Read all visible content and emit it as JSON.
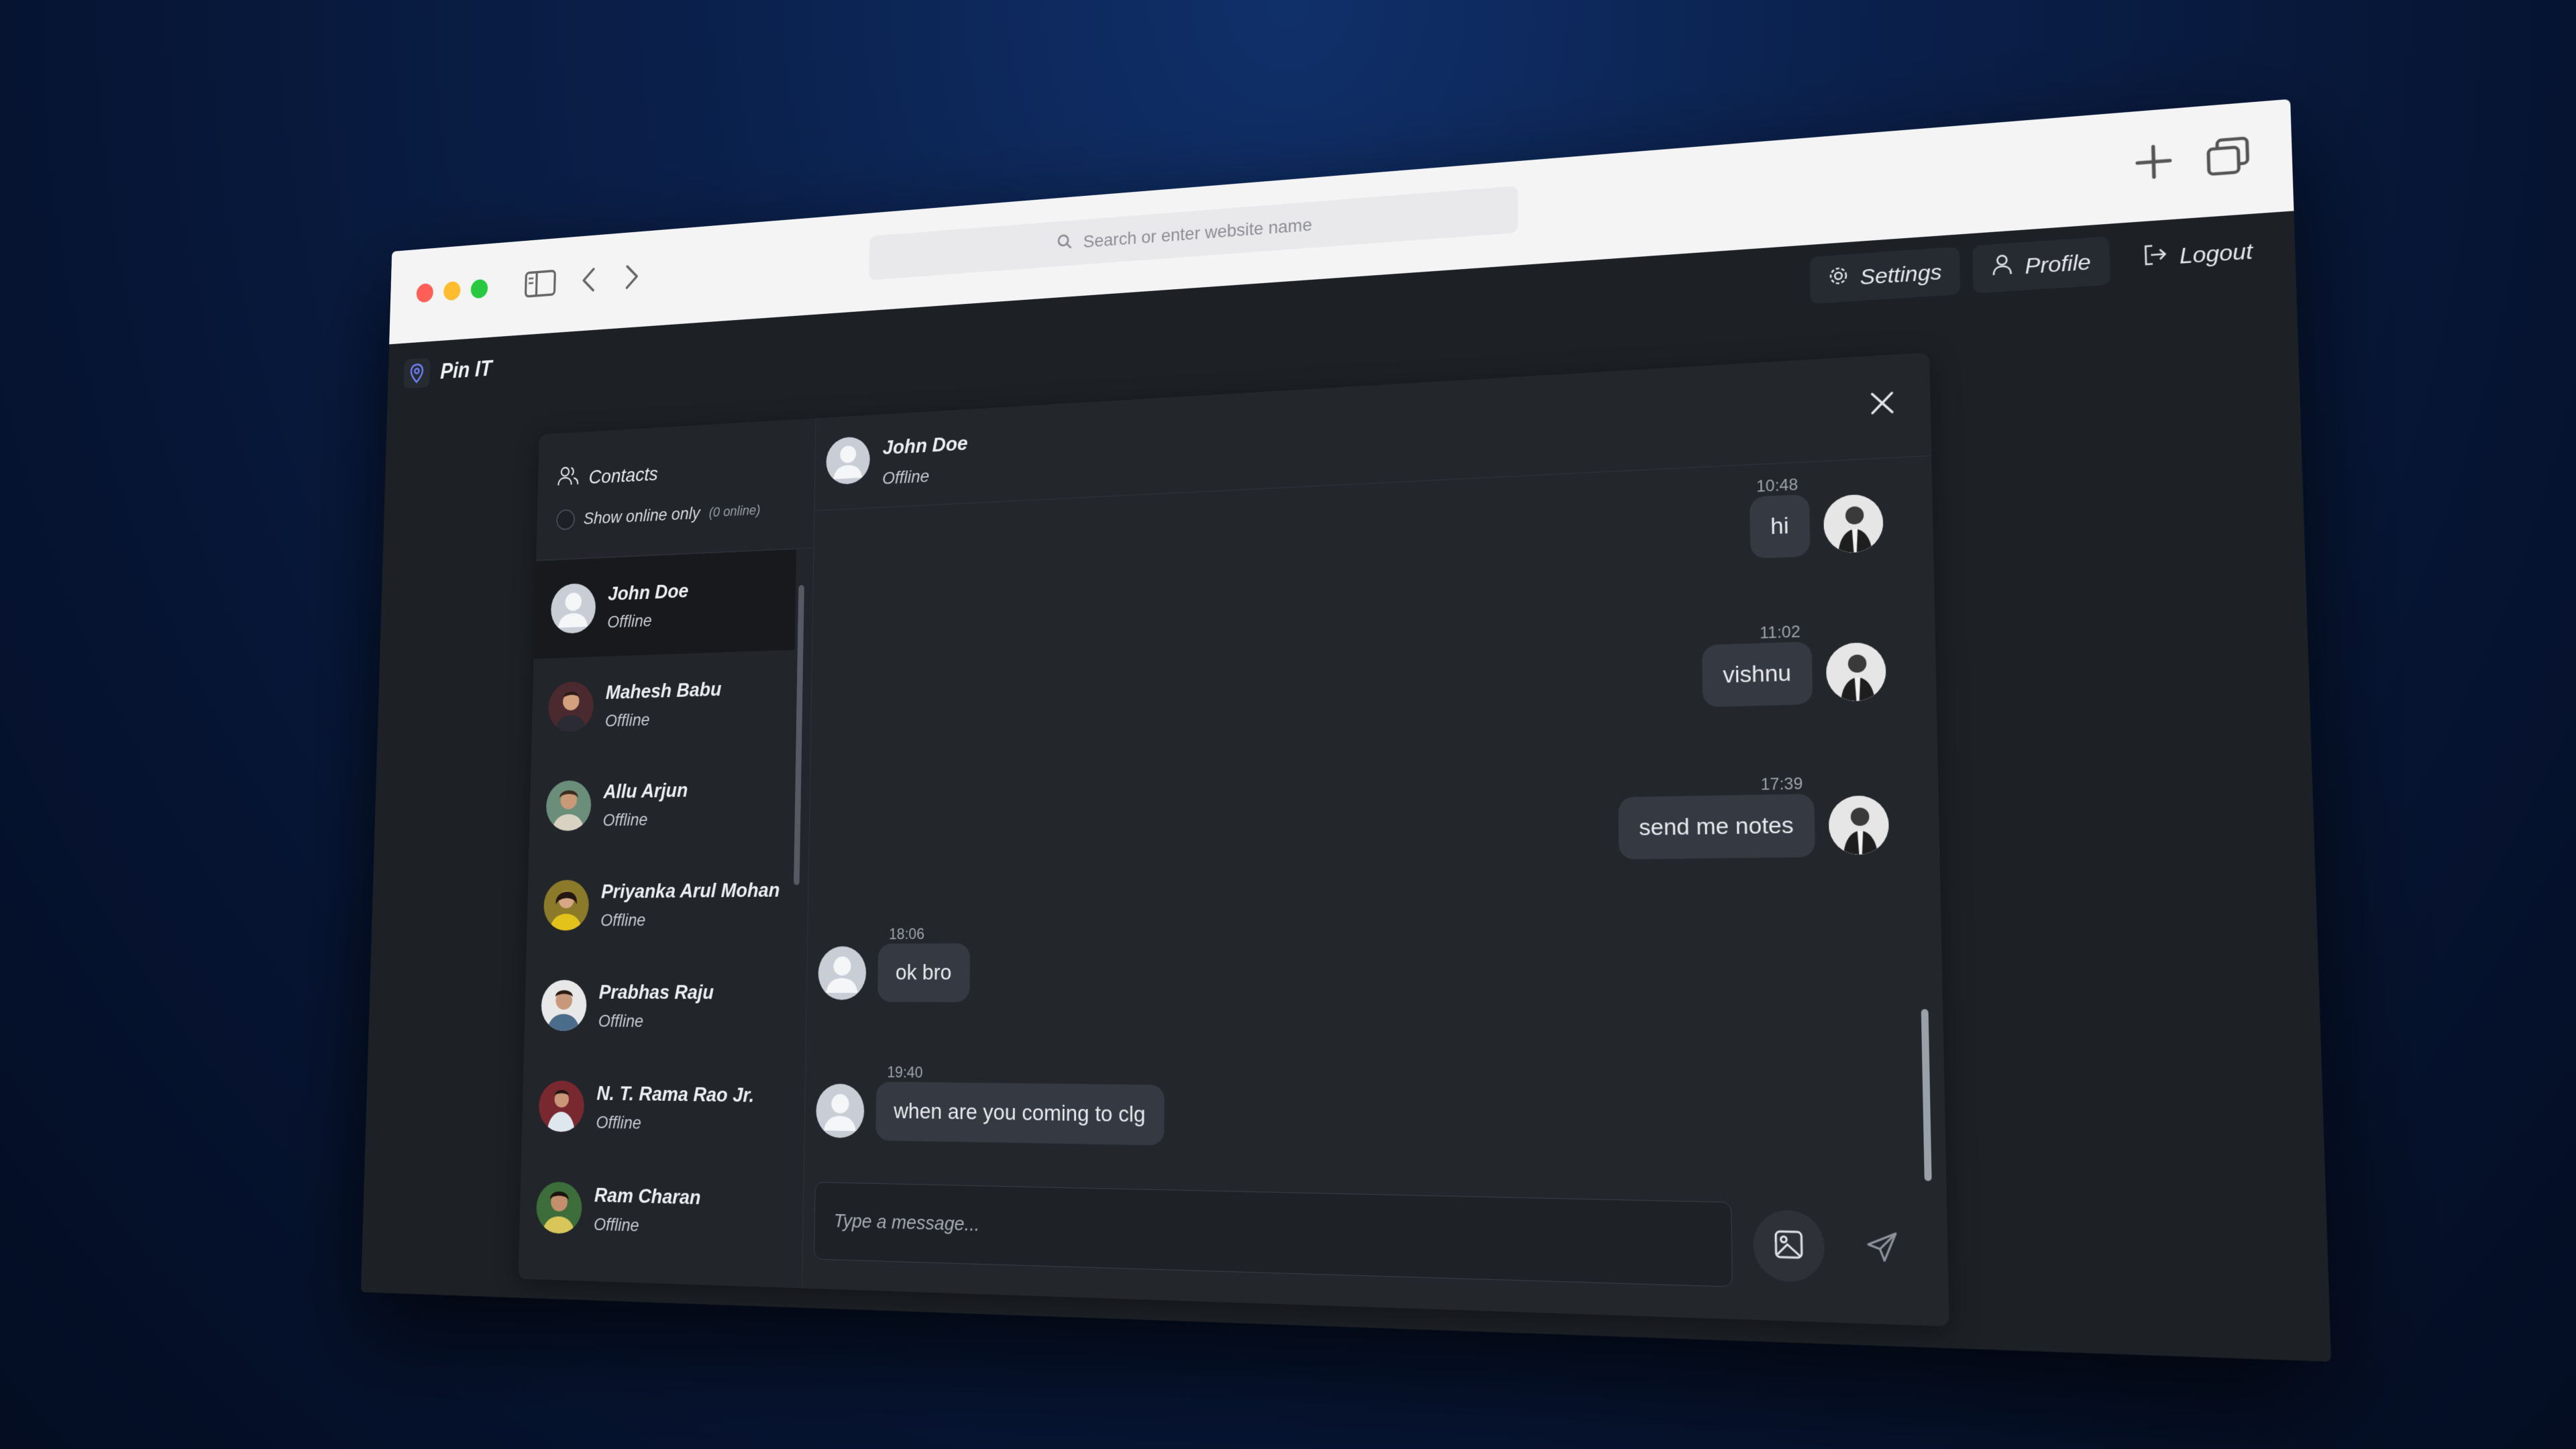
{
  "browser": {
    "address_placeholder": "Search or enter website name"
  },
  "app": {
    "brand": "Pin IT",
    "nav": {
      "settings": "Settings",
      "profile": "Profile",
      "logout": "Logout"
    }
  },
  "sidebar": {
    "title": "Contacts",
    "online_filter_label": "Show online only",
    "online_count": "(0 online)",
    "contacts": [
      {
        "name": "John Doe",
        "status": "Offline"
      },
      {
        "name": "Mahesh Babu",
        "status": "Offline"
      },
      {
        "name": "Allu Arjun",
        "status": "Offline"
      },
      {
        "name": "Priyanka Arul Mohan",
        "status": "Offline"
      },
      {
        "name": "Prabhas Raju",
        "status": "Offline"
      },
      {
        "name": "N. T. Rama Rao Jr.",
        "status": "Offline"
      },
      {
        "name": "Ram Charan",
        "status": "Offline"
      }
    ]
  },
  "chat": {
    "contact_name": "John Doe",
    "contact_status": "Offline",
    "messages": [
      {
        "time": "10:48",
        "text": "hi",
        "direction": "out"
      },
      {
        "time": "11:02",
        "text": "vishnu",
        "direction": "out"
      },
      {
        "time": "17:39",
        "text": "send me notes",
        "direction": "out"
      },
      {
        "time": "18:06",
        "text": "ok bro",
        "direction": "in"
      },
      {
        "time": "19:40",
        "text": "when are you coming to clg",
        "direction": "in"
      }
    ],
    "input_placeholder": "Type a message..."
  },
  "colors": {
    "background": "#0a1f49",
    "app_bg": "#1d2025",
    "bubble": "#353941",
    "brand_icon": "#5b6ef5",
    "traffic_red": "#ff5f57",
    "traffic_yellow": "#febc2e",
    "traffic_green": "#28c840"
  }
}
